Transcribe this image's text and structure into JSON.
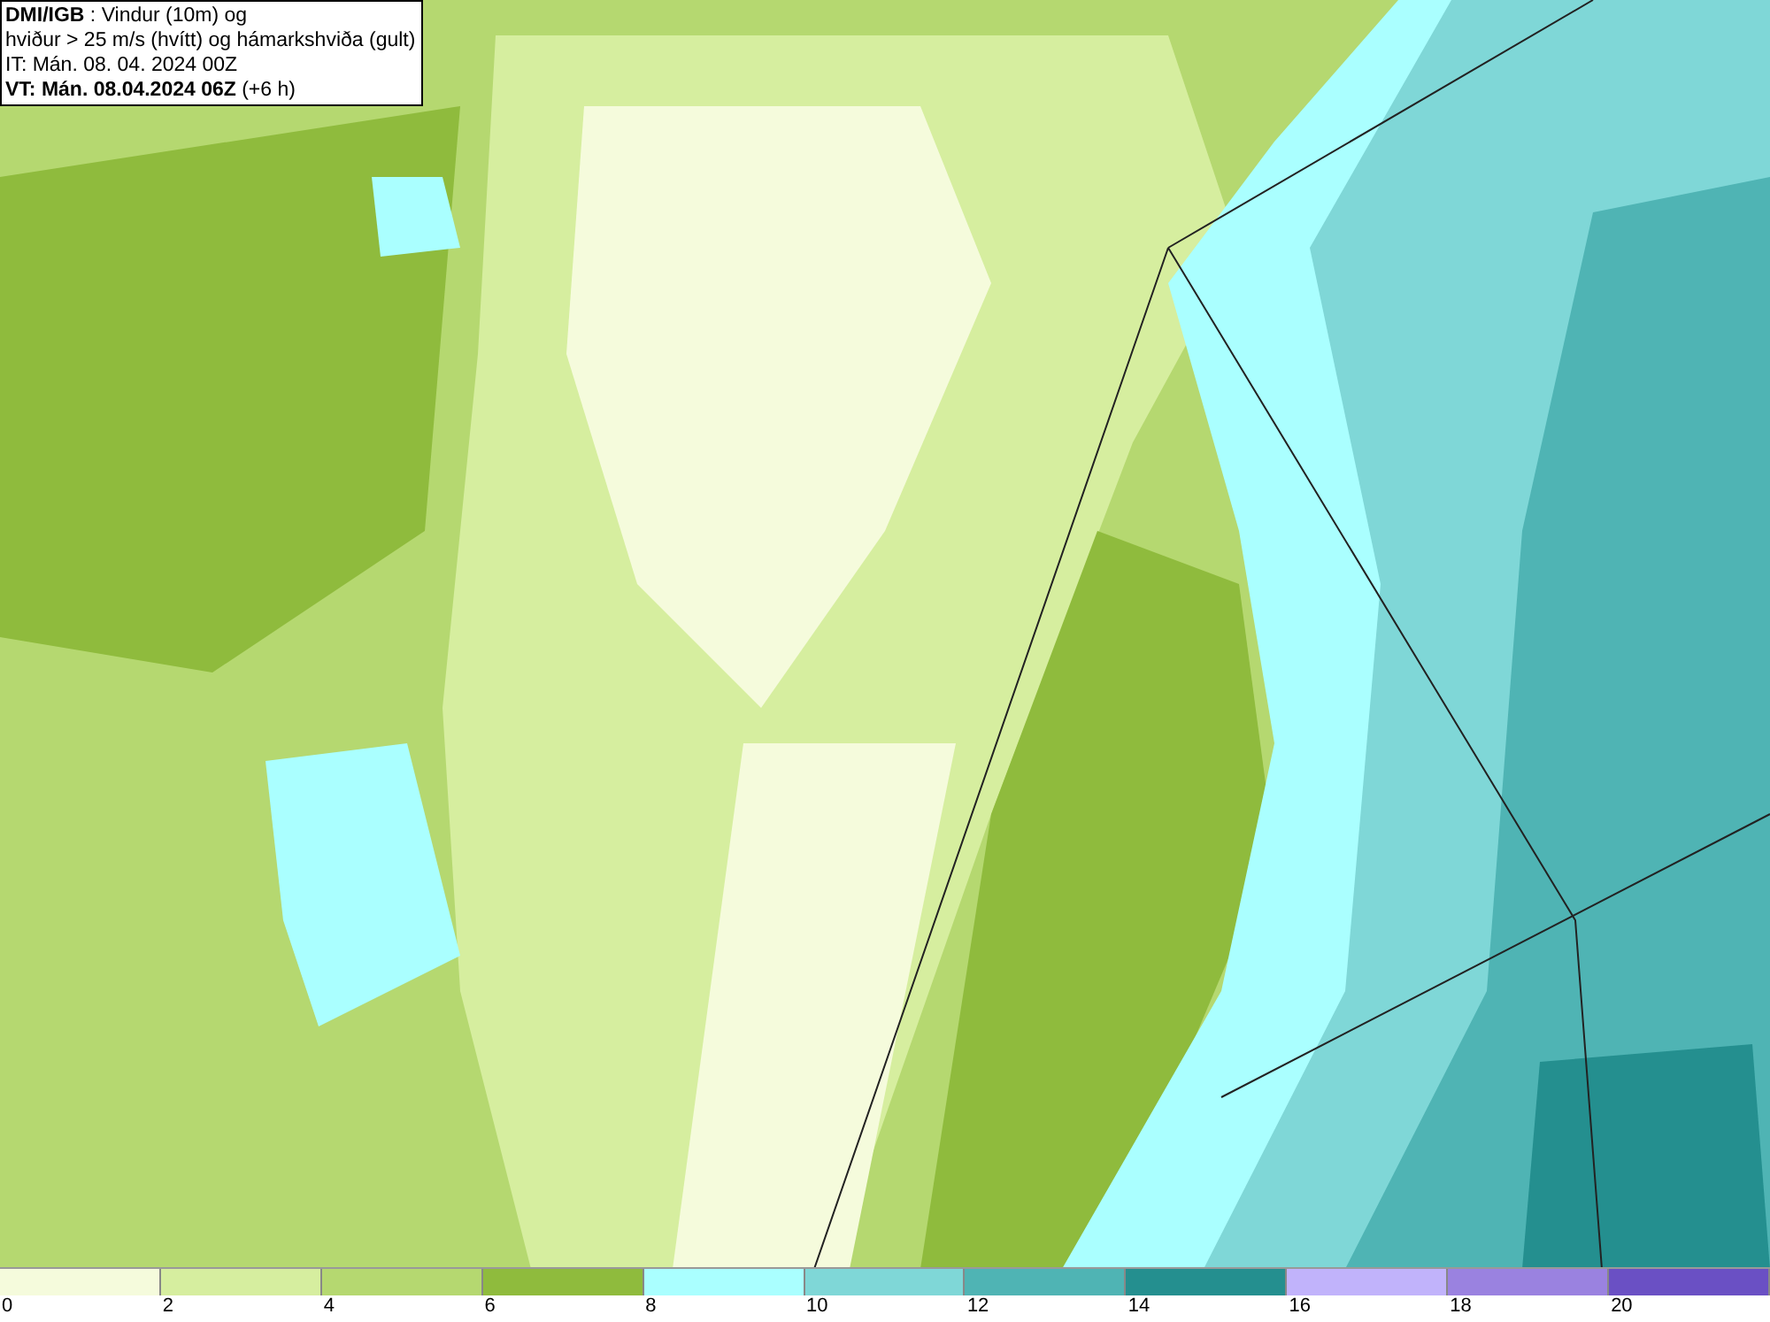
{
  "info_box": {
    "lines": [
      "**DMI/IGB** : Vindur (10m) og",
      "hviður > 25 m/s (hvítt) og hámarkshviða (gult)",
      "IT: Mán. 08. 04. 2024 00Z",
      "**VT: Mán. 08.04.2024 06Z** (+6 h)"
    ]
  },
  "legend": [
    {
      "label": "0",
      "color": "#f5fbdc"
    },
    {
      "label": "2",
      "color": "#d6ee9f"
    },
    {
      "label": "4",
      "color": "#b5d870"
    },
    {
      "label": "6",
      "color": "#8fbb3d"
    },
    {
      "label": "8",
      "color": "#aaffff"
    },
    {
      "label": "10",
      "color": "#7fd7d7"
    },
    {
      "label": "12",
      "color": "#4fb4b4"
    },
    {
      "label": "14",
      "color": "#248f8f"
    },
    {
      "label": "16",
      "color": "#c1b3fb"
    },
    {
      "label": "18",
      "color": "#9a82e0"
    },
    {
      "label": "20",
      "color": "#6a50c4"
    }
  ]
}
